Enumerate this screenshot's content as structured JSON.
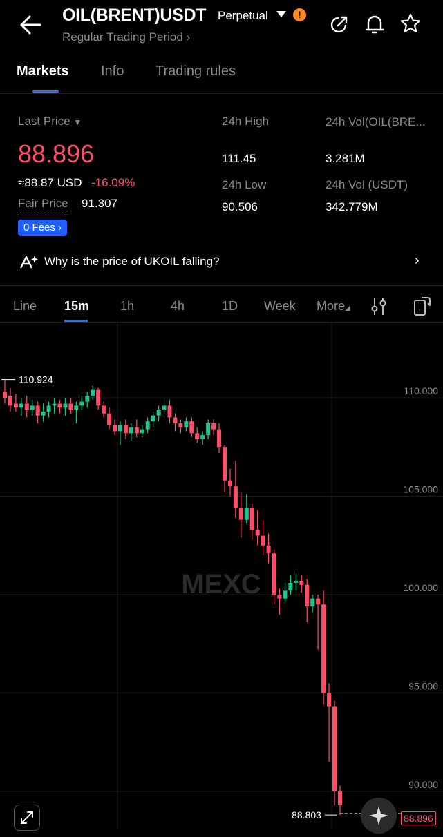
{
  "header": {
    "symbol": "OIL(BRENT)USDT",
    "contract_type": "Perpetual",
    "subtitle": "Regular Trading Period ›"
  },
  "tabs": [
    {
      "label": "Markets",
      "active": true
    },
    {
      "label": "Info",
      "active": false
    },
    {
      "label": "Trading rules",
      "active": false
    }
  ],
  "stats": {
    "last_price_label": "Last Price",
    "last_price": "88.896",
    "usd_price": "≈88.87 USD",
    "change_pct": "-16.09%",
    "fair_price_label": "Fair Price",
    "fair_price": "91.307",
    "fees_label": "0 Fees ›",
    "high_label": "24h High",
    "high_value": "111.45",
    "vol_base_label": "24h Vol(OIL(BRE...",
    "vol_base_value": "3.281M",
    "low_label": "24h Low",
    "low_value": "90.506",
    "vol_usdt_label": "24h Vol (USDT)",
    "vol_usdt_value": "342.779M"
  },
  "news": {
    "text": "Why is the price of UKOIL falling?"
  },
  "intervals": [
    {
      "label": "Line",
      "active": false
    },
    {
      "label": "15m",
      "active": true
    },
    {
      "label": "1h",
      "active": false
    },
    {
      "label": "4h",
      "active": false
    },
    {
      "label": "1D",
      "active": false
    },
    {
      "label": "Week",
      "active": false
    },
    {
      "label": "More",
      "active": false
    }
  ],
  "watermark": "MEXC",
  "colors": {
    "up": "#1ec48b",
    "down": "#ff4d6a",
    "accent": "#2f6dff"
  },
  "chart_data": {
    "type": "candlestick",
    "y_ticks": [
      "110.000",
      "105.000",
      "100.000",
      "95.000",
      "90.000"
    ],
    "ylim": [
      88,
      113
    ],
    "high_marker": "110.924",
    "low_marker": "88.803",
    "last_price_tag": "88.896",
    "candles": [
      {
        "o": 110.3,
        "h": 110.9,
        "c": 110.0,
        "l": 109.7
      },
      {
        "o": 110.1,
        "h": 110.5,
        "c": 109.6,
        "l": 109.3
      },
      {
        "o": 109.7,
        "h": 110.2,
        "c": 109.5,
        "l": 109.3
      },
      {
        "o": 109.5,
        "h": 110.0,
        "c": 109.7,
        "l": 109.1
      },
      {
        "o": 109.7,
        "h": 110.1,
        "c": 109.4,
        "l": 109.0
      },
      {
        "o": 109.4,
        "h": 109.9,
        "c": 109.6,
        "l": 109.1
      },
      {
        "o": 109.6,
        "h": 109.8,
        "c": 109.1,
        "l": 108.7
      },
      {
        "o": 109.1,
        "h": 109.7,
        "c": 109.3,
        "l": 108.8
      },
      {
        "o": 109.3,
        "h": 109.8,
        "c": 109.6,
        "l": 109.0
      },
      {
        "o": 109.6,
        "h": 110.0,
        "c": 109.7,
        "l": 109.2
      },
      {
        "o": 109.7,
        "h": 109.9,
        "c": 109.5,
        "l": 109.2
      },
      {
        "o": 109.5,
        "h": 110.0,
        "c": 109.7,
        "l": 109.1
      },
      {
        "o": 109.7,
        "h": 110.0,
        "c": 109.4,
        "l": 109.2
      },
      {
        "o": 109.4,
        "h": 109.8,
        "c": 109.6,
        "l": 108.7
      },
      {
        "o": 109.6,
        "h": 110.1,
        "c": 109.8,
        "l": 109.4
      },
      {
        "o": 109.8,
        "h": 110.3,
        "c": 110.1,
        "l": 109.5
      },
      {
        "o": 110.1,
        "h": 110.6,
        "c": 110.4,
        "l": 109.9
      },
      {
        "o": 110.4,
        "h": 110.5,
        "c": 109.6,
        "l": 109.4
      },
      {
        "o": 109.6,
        "h": 109.8,
        "c": 109.2,
        "l": 109.0
      },
      {
        "o": 109.2,
        "h": 109.5,
        "c": 108.6,
        "l": 108.4
      },
      {
        "o": 108.6,
        "h": 108.9,
        "c": 108.3,
        "l": 108.1
      },
      {
        "o": 108.3,
        "h": 108.8,
        "c": 108.6,
        "l": 107.6
      },
      {
        "o": 108.6,
        "h": 108.9,
        "c": 108.2,
        "l": 107.9
      },
      {
        "o": 108.2,
        "h": 108.7,
        "c": 108.5,
        "l": 107.8
      },
      {
        "o": 108.5,
        "h": 108.9,
        "c": 108.2,
        "l": 108.0
      },
      {
        "o": 108.2,
        "h": 108.6,
        "c": 108.4,
        "l": 108.0
      },
      {
        "o": 108.4,
        "h": 109.0,
        "c": 108.8,
        "l": 108.2
      },
      {
        "o": 108.8,
        "h": 109.3,
        "c": 109.1,
        "l": 108.5
      },
      {
        "o": 109.1,
        "h": 109.6,
        "c": 109.4,
        "l": 108.8
      },
      {
        "o": 109.4,
        "h": 110.0,
        "c": 109.6,
        "l": 109.0
      },
      {
        "o": 109.6,
        "h": 109.9,
        "c": 109.0,
        "l": 108.7
      },
      {
        "o": 109.0,
        "h": 109.2,
        "c": 108.7,
        "l": 108.3
      },
      {
        "o": 108.7,
        "h": 108.9,
        "c": 108.5,
        "l": 108.2
      },
      {
        "o": 108.5,
        "h": 109.0,
        "c": 108.8,
        "l": 108.3
      },
      {
        "o": 108.8,
        "h": 109.0,
        "c": 108.2,
        "l": 108.0
      },
      {
        "o": 108.2,
        "h": 108.5,
        "c": 107.9,
        "l": 107.7
      },
      {
        "o": 107.9,
        "h": 108.3,
        "c": 108.1,
        "l": 107.6
      },
      {
        "o": 108.1,
        "h": 108.9,
        "c": 108.7,
        "l": 107.9
      },
      {
        "o": 108.7,
        "h": 108.9,
        "c": 108.4,
        "l": 108.1
      },
      {
        "o": 108.4,
        "h": 108.7,
        "c": 107.5,
        "l": 107.2
      },
      {
        "o": 107.5,
        "h": 107.6,
        "c": 105.8,
        "l": 105.2
      },
      {
        "o": 105.8,
        "h": 106.4,
        "c": 105.5,
        "l": 105.0
      },
      {
        "o": 105.5,
        "h": 106.8,
        "c": 104.4,
        "l": 103.9
      },
      {
        "o": 104.4,
        "h": 105.2,
        "c": 103.8,
        "l": 102.9
      },
      {
        "o": 103.8,
        "h": 105.1,
        "c": 104.4,
        "l": 103.6
      },
      {
        "o": 104.4,
        "h": 104.6,
        "c": 103.3,
        "l": 102.8
      },
      {
        "o": 103.3,
        "h": 104.3,
        "c": 103.0,
        "l": 102.5
      },
      {
        "o": 103.0,
        "h": 103.8,
        "c": 102.5,
        "l": 102.0
      },
      {
        "o": 102.5,
        "h": 103.1,
        "c": 102.1,
        "l": 101.6
      },
      {
        "o": 102.1,
        "h": 102.3,
        "c": 100.0,
        "l": 99.5
      },
      {
        "o": 100.0,
        "h": 100.3,
        "c": 99.8,
        "l": 99.0
      },
      {
        "o": 99.8,
        "h": 100.6,
        "c": 100.2,
        "l": 99.6
      },
      {
        "o": 100.2,
        "h": 101.0,
        "c": 100.6,
        "l": 100.0
      },
      {
        "o": 100.6,
        "h": 101.1,
        "c": 100.7,
        "l": 100.2
      },
      {
        "o": 100.7,
        "h": 101.0,
        "c": 100.5,
        "l": 100.1
      },
      {
        "o": 100.5,
        "h": 100.8,
        "c": 99.4,
        "l": 98.6
      },
      {
        "o": 99.4,
        "h": 100.0,
        "c": 99.8,
        "l": 99.1
      },
      {
        "o": 99.8,
        "h": 100.0,
        "c": 99.5,
        "l": 97.2
      },
      {
        "o": 99.5,
        "h": 100.2,
        "c": 95.0,
        "l": 94.4
      },
      {
        "o": 95.0,
        "h": 95.5,
        "c": 94.3,
        "l": 91.5
      },
      {
        "o": 94.3,
        "h": 94.6,
        "c": 90.0,
        "l": 89.3
      },
      {
        "o": 90.0,
        "h": 90.3,
        "c": 89.3,
        "l": 88.8
      }
    ]
  }
}
